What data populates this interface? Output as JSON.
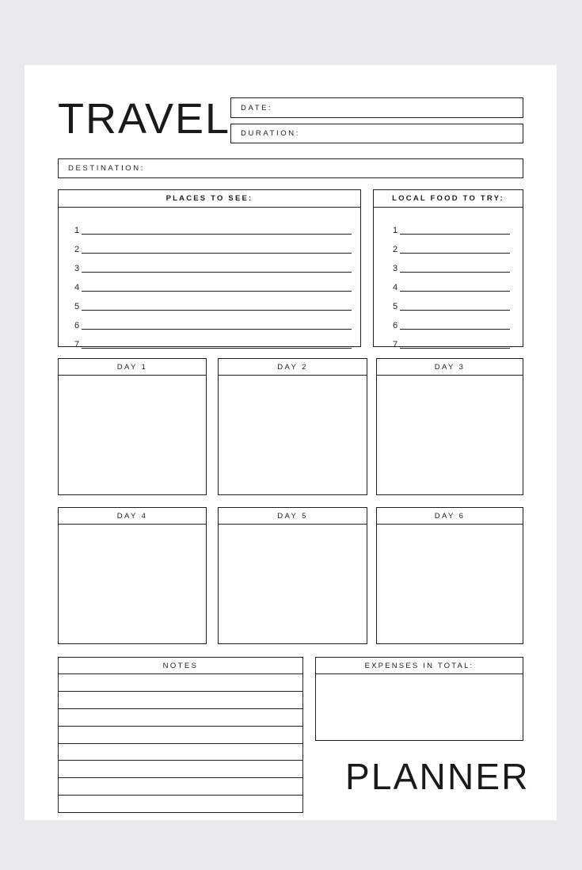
{
  "document": {
    "title_word": "TRAVEL",
    "footer_word": "PLANNER",
    "page_background": "#ffffff",
    "canvas_background": "#e9e9ee",
    "ink_color": "#231f20"
  },
  "header": {
    "fields": [
      {
        "label": "DATE:",
        "value": ""
      },
      {
        "label": "DURATION:",
        "value": ""
      }
    ],
    "destination": {
      "label": "DESTINATION:",
      "value": ""
    }
  },
  "lists": {
    "places": {
      "heading": "PLACES TO SEE:",
      "rows": [
        {
          "num": "1",
          "value": ""
        },
        {
          "num": "2",
          "value": ""
        },
        {
          "num": "3",
          "value": ""
        },
        {
          "num": "4",
          "value": ""
        },
        {
          "num": "5",
          "value": ""
        },
        {
          "num": "6",
          "value": ""
        },
        {
          "num": "7",
          "value": ""
        }
      ]
    },
    "food": {
      "heading": "LOCAL FOOD TO TRY:",
      "rows": [
        {
          "num": "1",
          "value": ""
        },
        {
          "num": "2",
          "value": ""
        },
        {
          "num": "3",
          "value": ""
        },
        {
          "num": "4",
          "value": ""
        },
        {
          "num": "5",
          "value": ""
        },
        {
          "num": "6",
          "value": ""
        },
        {
          "num": "7",
          "value": ""
        }
      ]
    }
  },
  "days": [
    {
      "label": "DAY 1",
      "value": ""
    },
    {
      "label": "DAY 2",
      "value": ""
    },
    {
      "label": "DAY 3",
      "value": ""
    },
    {
      "label": "DAY 4",
      "value": ""
    },
    {
      "label": "DAY 5",
      "value": ""
    },
    {
      "label": "DAY 6",
      "value": ""
    }
  ],
  "notes": {
    "heading": "NOTES",
    "line_count": 8,
    "lines": [
      "",
      "",
      "",
      "",
      "",
      "",
      "",
      ""
    ]
  },
  "expenses": {
    "heading": "EXPENSES IN TOTAL:",
    "value": ""
  }
}
